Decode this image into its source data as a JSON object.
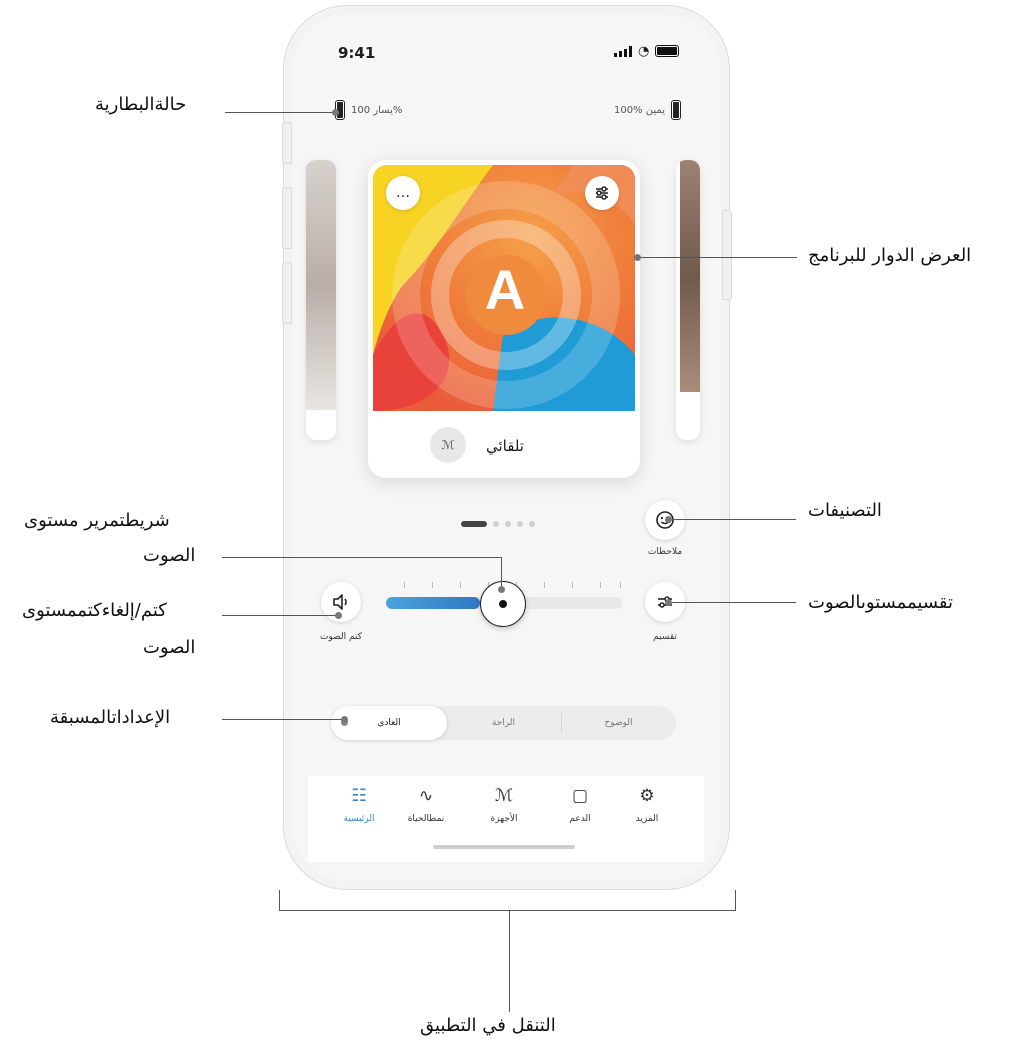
{
  "status_bar": {
    "time": "9:41"
  },
  "battery": {
    "left": "يسار 100%",
    "right": "100% يمين"
  },
  "program": {
    "name": "تلقائي",
    "letter": "A",
    "more_icon": "…",
    "settings_icon": "sliders"
  },
  "carousel": {
    "active_index": 0,
    "count": 5
  },
  "actions": {
    "feedback": "ملاحظات",
    "split": "تقسيم",
    "mute": "كتم الصوت"
  },
  "volume": {
    "level": 0.5
  },
  "presets": {
    "items": [
      "الوضوح",
      "الراحة",
      "العادي"
    ],
    "selected": "العادي"
  },
  "tabs": [
    {
      "label": "المزيد",
      "icon": "gear-icon"
    },
    {
      "label": "الدعم",
      "icon": "chat-icon"
    },
    {
      "label": "الأجهزة",
      "icon": "hearing-aid-icon"
    },
    {
      "label": "نمطالحياة",
      "icon": "pulse-icon"
    },
    {
      "label": "الرئيسية",
      "icon": "grid-icon",
      "active": true
    }
  ],
  "callouts": {
    "battery": "حالةالبطارية",
    "carousel": "العرض الدوار للبرنامج",
    "ratings": "التصنيفات",
    "slider_line1": "شريطتمرير مستوى",
    "slider_line2": "الصوت",
    "mute_line1": "كتم/إلغاءكتممستوى",
    "mute_line2": "الصوت",
    "split": "تقسيممستوىالصوت",
    "presets": "الإعداداتالمسبقة",
    "navigation": "التنقل في التطبيق"
  },
  "colors": {
    "accent": "#2e86c8",
    "slider_fill": "#3b8fd0"
  }
}
